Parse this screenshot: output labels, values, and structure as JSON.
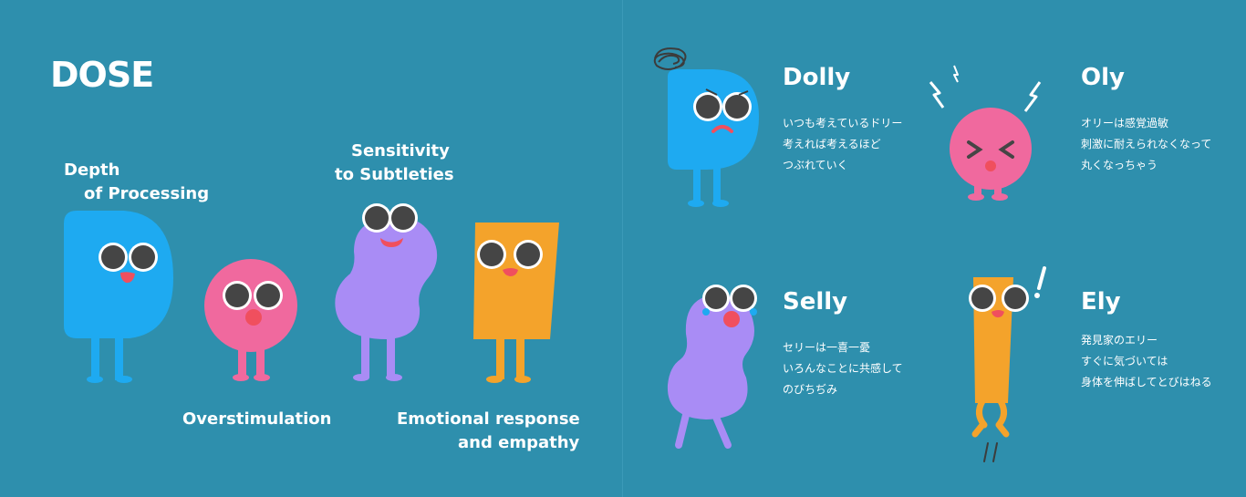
{
  "title": "DOSE",
  "dose": {
    "depth": [
      "Depth",
      "of Processing"
    ],
    "overstimulation": "Overstimulation",
    "sensitivity": [
      "Sensitivity",
      "to Subtleties"
    ],
    "emotional": [
      "Emotional response",
      "and empathy"
    ]
  },
  "characters": {
    "dolly": {
      "name": "Dolly",
      "lines": [
        "いつも考えているドリー",
        "考えれば考えるほど",
        "つぶれていく"
      ],
      "color": "#1eaaf1"
    },
    "oly": {
      "name": "Oly",
      "lines": [
        "オリーは感覚過敏",
        "刺激に耐えられなくなって",
        "丸くなっちゃう"
      ],
      "color": "#f0699e"
    },
    "selly": {
      "name": "Selly",
      "lines": [
        "セリーは一喜一憂",
        "いろんなことに共感して",
        "のびちぢみ"
      ],
      "color": "#a98cf5"
    },
    "ely": {
      "name": "Ely",
      "lines": [
        "発見家のエリー",
        "すぐに気づいては",
        "身体を伸ばしてとびはねる"
      ],
      "color": "#f4a32b"
    }
  }
}
